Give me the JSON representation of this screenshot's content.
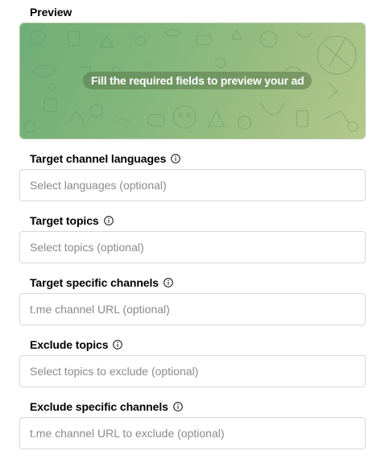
{
  "preview": {
    "title": "Preview",
    "message": "Fill the required fields to preview your ad",
    "colors": {
      "background_start": "#6fae77",
      "background_end": "#b4c98b"
    }
  },
  "fields": [
    {
      "label": "Target channel languages",
      "placeholder": "Select languages (optional)",
      "icon": "info-icon"
    },
    {
      "label": "Target topics",
      "placeholder": "Select topics (optional)",
      "icon": "info-icon"
    },
    {
      "label": "Target specific channels",
      "placeholder": "t.me channel URL (optional)",
      "icon": "info-icon"
    },
    {
      "label": "Exclude topics",
      "placeholder": "Select topics to exclude (optional)",
      "icon": "info-icon"
    },
    {
      "label": "Exclude specific channels",
      "placeholder": "t.me channel URL to exclude (optional)",
      "icon": "info-icon"
    }
  ]
}
